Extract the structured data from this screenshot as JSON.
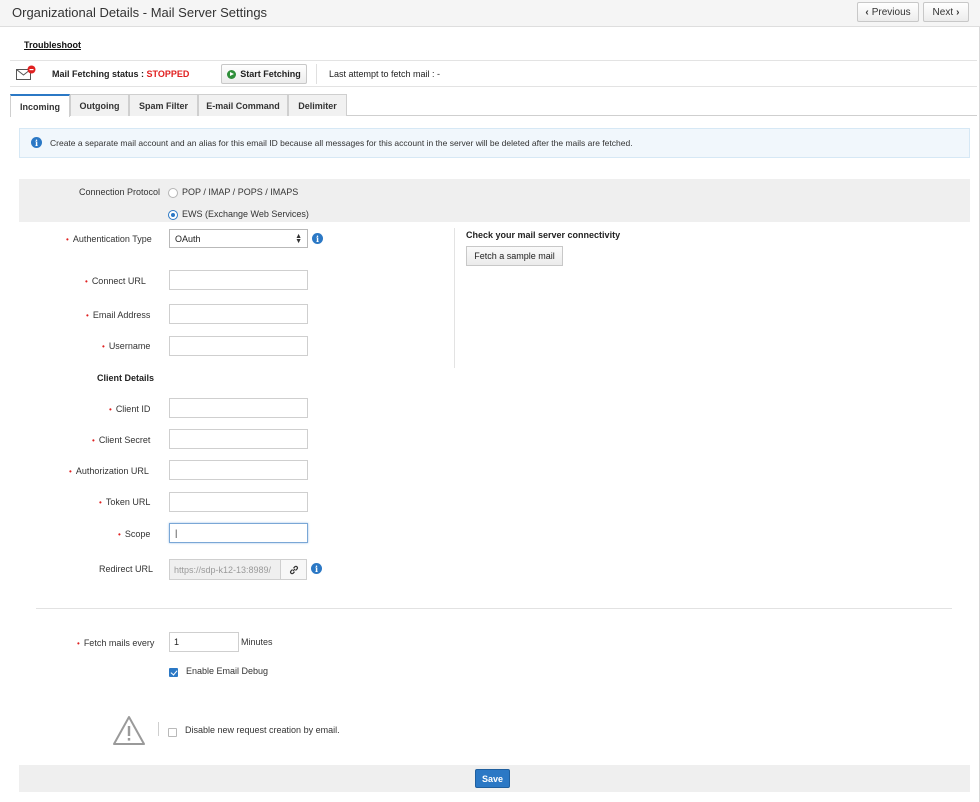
{
  "header": {
    "title": "Organizational Details - Mail Server Settings",
    "prev_label": "Previous",
    "next_label": "Next"
  },
  "troubleshoot_label": "Troubleshoot",
  "status": {
    "label": "Mail Fetching status :",
    "value": "STOPPED",
    "start_label": "Start Fetching",
    "last_attempt": "Last attempt to fetch mail : -"
  },
  "tabs": [
    {
      "label": "Incoming",
      "active": true
    },
    {
      "label": "Outgoing",
      "active": false
    },
    {
      "label": "Spam Filter",
      "active": false
    },
    {
      "label": "E-mail Command",
      "active": false
    },
    {
      "label": "Delimiter",
      "active": false
    }
  ],
  "info_text": "Create a separate mail account and an alias for this email ID because all messages for this account in the server will be deleted after the mails are fetched.",
  "protocol": {
    "label": "Connection Protocol",
    "options": [
      "POP / IMAP / POPS / IMAPS",
      "EWS (Exchange Web Services)"
    ],
    "selected": "EWS (Exchange Web Services)"
  },
  "form": {
    "auth_type_label": "Authentication Type",
    "auth_type_value": "OAuth",
    "connect_url_label": "Connect URL",
    "email_label": "Email Address",
    "username_label": "Username",
    "client_details_heading": "Client Details",
    "client_id_label": "Client ID",
    "client_secret_label": "Client Secret",
    "authorization_url_label": "Authorization URL",
    "token_url_label": "Token URL",
    "scope_label": "Scope",
    "scope_value": "|",
    "redirect_url_label": "Redirect URL",
    "redirect_url_value": "https://sdp-k12-13:8989/",
    "fetch_every_label": "Fetch mails every",
    "fetch_every_value": "1",
    "fetch_every_unit": "Minutes",
    "email_debug_label": "Enable Email Debug",
    "disable_request_label": "Disable new request creation by email."
  },
  "connectivity": {
    "heading": "Check your mail server connectivity",
    "button_label": "Fetch a sample mail"
  },
  "footer": {
    "save_label": "Save"
  },
  "colors": {
    "accent": "#2b78c5",
    "error": "#e02020"
  }
}
